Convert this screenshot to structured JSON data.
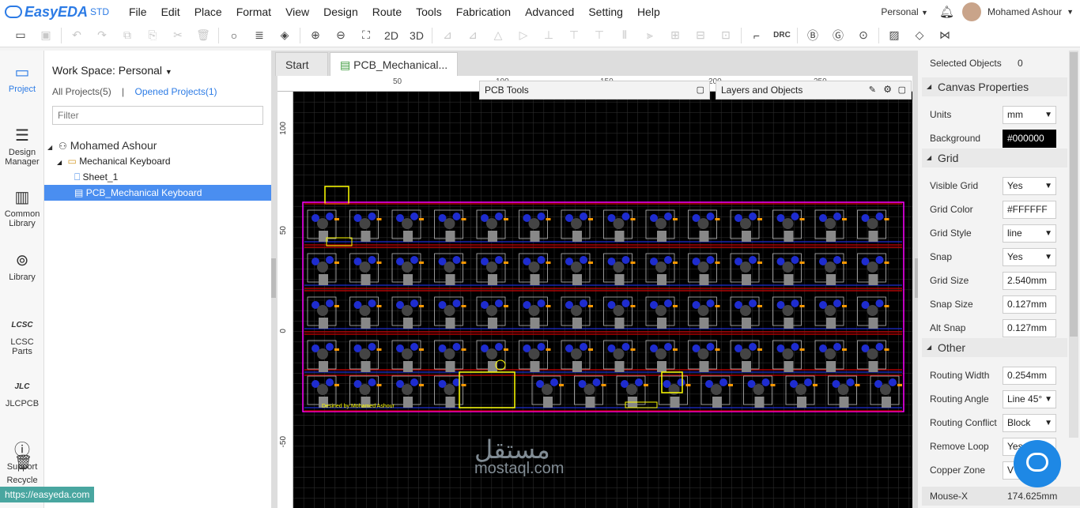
{
  "app": {
    "brand": "EasyEDA",
    "edition": "STD",
    "menu": [
      "File",
      "Edit",
      "Place",
      "Format",
      "View",
      "Design",
      "Route",
      "Tools",
      "Fabrication",
      "Advanced",
      "Setting",
      "Help"
    ],
    "workspace_menu": "Personal",
    "user_name": "Mohamed Ashour"
  },
  "toolbar": {
    "btn_2d": "2D",
    "btn_3d": "3D",
    "drc": "DRC",
    "icons": [
      "folder-open-icon",
      "save-icon",
      "undo-icon",
      "redo-icon",
      "copy-icon",
      "paste-icon",
      "cut-icon",
      "delete-icon",
      "search-icon",
      "find-similar-icon",
      "eraser-icon",
      "zoom-in-icon",
      "zoom-out-icon",
      "fit-icon"
    ]
  },
  "leftnav": [
    {
      "label": "Project",
      "icon": "project-icon"
    },
    {
      "label": "Design Manager",
      "icon": "design-manager-icon"
    },
    {
      "label": "Common Library",
      "icon": "common-library-icon"
    },
    {
      "label": "Library",
      "icon": "library-icon"
    },
    {
      "label": "LCSC Parts",
      "icon": "lcsc-icon"
    },
    {
      "label": "JLCPCB",
      "icon": "jlc-icon"
    },
    {
      "label": "Support",
      "icon": "help-icon"
    },
    {
      "label": "Recycle",
      "icon": "recycle-icon"
    }
  ],
  "project_panel": {
    "workspace_label": "Work Space: Personal",
    "all_projects": "All Projects(5)",
    "divider": "|",
    "opened_projects": "Opened Projects(1)",
    "filter_placeholder": "Filter",
    "tree": {
      "owner": "Mohamed Ashour",
      "project": "Mechanical Keyboard",
      "sheet": "Sheet_1",
      "pcb": "PCB_Mechanical Keyboard"
    }
  },
  "canvas": {
    "tabs": [
      "Start",
      "PCB_Mechanical..."
    ],
    "ruler_top": [
      "50",
      "100",
      "150",
      "200",
      "250"
    ],
    "ruler_left": [
      "100",
      "50",
      "0",
      "-50"
    ],
    "pcb_tools_title": "PCB Tools",
    "layers_title": "Layers and Objects",
    "silk_credit": "Desined by:Mohamed Ashour",
    "colors": {
      "board_bg": "#000000",
      "grid": "#2b2b2b",
      "outline": "#ff00ff",
      "silk": "#ffff00",
      "top": "#cc0000",
      "bottom": "#1e2ccf",
      "pad": "#888888"
    }
  },
  "right_panel": {
    "selected_label": "Selected Objects",
    "selected_count": "0",
    "sections": {
      "canvas": "Canvas Properties",
      "grid": "Grid",
      "other": "Other"
    },
    "canvas_props": [
      {
        "label": "Units",
        "value": "mm",
        "dropdown": true
      },
      {
        "label": "Background",
        "value": "#000000",
        "dark": true
      }
    ],
    "grid_props": [
      {
        "label": "Visible Grid",
        "value": "Yes",
        "dropdown": true
      },
      {
        "label": "Grid Color",
        "value": "#FFFFFF"
      },
      {
        "label": "Grid Style",
        "value": "line",
        "dropdown": true
      },
      {
        "label": "Snap",
        "value": "Yes",
        "dropdown": true
      },
      {
        "label": "Grid Size",
        "value": "2.540mm"
      },
      {
        "label": "Snap Size",
        "value": "0.127mm"
      },
      {
        "label": "Alt Snap",
        "value": "0.127mm"
      }
    ],
    "other_props": [
      {
        "label": "Routing Width",
        "value": "0.254mm"
      },
      {
        "label": "Routing Angle",
        "value": "Line 45°",
        "dropdown": true
      },
      {
        "label": "Routing Conflict",
        "value": "Block",
        "dropdown": true
      },
      {
        "label": "Remove Loop",
        "value": "Yes",
        "dropdown": true
      },
      {
        "label": "Copper Zone",
        "value": "V"
      }
    ],
    "mouse_x_label": "Mouse-X",
    "mouse_x_value": "174.625mm"
  },
  "status_url": "https://easyeda.com",
  "watermark": {
    "arabic": "مستقل",
    "latin": "mostaql.com"
  }
}
